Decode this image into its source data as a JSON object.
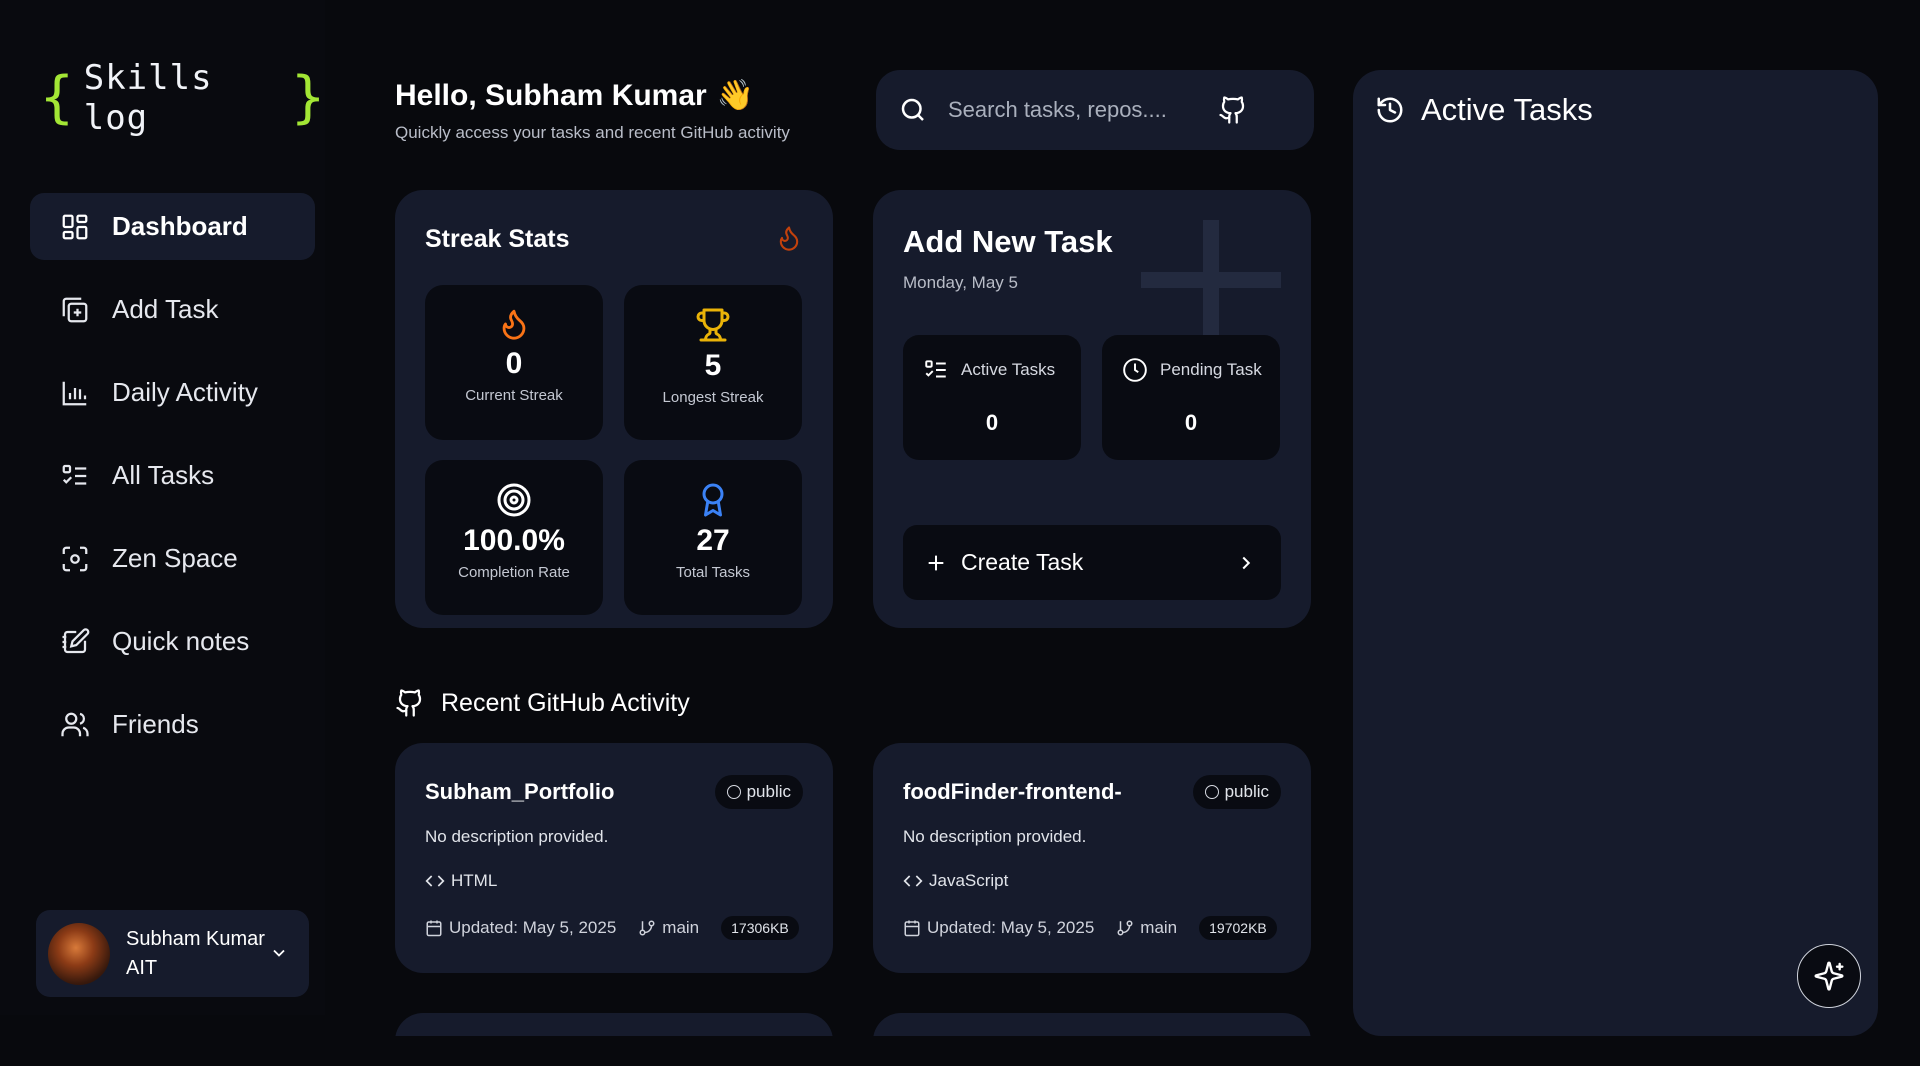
{
  "logo": {
    "open_brace": "{",
    "text": "Skills log",
    "close_brace": "}"
  },
  "sidebar": {
    "items": [
      {
        "label": "Dashboard",
        "icon": "dashboard-icon",
        "active": true
      },
      {
        "label": "Add Task",
        "icon": "add-task-icon"
      },
      {
        "label": "Daily Activity",
        "icon": "bar-chart-icon"
      },
      {
        "label": "All Tasks",
        "icon": "list-check-icon"
      },
      {
        "label": "Zen Space",
        "icon": "focus-icon"
      },
      {
        "label": "Quick notes",
        "icon": "notes-icon"
      },
      {
        "label": "Friends",
        "icon": "users-icon"
      }
    ]
  },
  "profile": {
    "name": "Subham Kumar",
    "org": "AIT"
  },
  "header": {
    "greeting": "Hello, Subham Kumar",
    "wave": "👋",
    "subtitle": "Quickly access your tasks and recent GitHub activity"
  },
  "search": {
    "placeholder": "Search tasks, repos...."
  },
  "streak": {
    "title": "Streak Stats",
    "stats": [
      {
        "value": "0",
        "label": "Current Streak",
        "icon": "flame-icon"
      },
      {
        "value": "5",
        "label": "Longest Streak",
        "icon": "trophy-icon"
      },
      {
        "value": "100.0%",
        "label": "Completion Rate",
        "icon": "target-icon"
      },
      {
        "value": "27",
        "label": "Total Tasks",
        "icon": "award-icon"
      }
    ]
  },
  "add_task": {
    "title": "Add New Task",
    "date": "Monday, May 5",
    "active_label": "Active Tasks",
    "active_count": "0",
    "pending_label": "Pending Task",
    "pending_count": "0",
    "create_label": "Create Task"
  },
  "github": {
    "title": "Recent GitHub Activity",
    "repos": [
      {
        "name": "Subham_Portfolio",
        "visibility": "public",
        "description": "No description provided.",
        "language": "HTML",
        "updated": "Updated: May 5, 2025",
        "branch": "main",
        "size": "17306KB"
      },
      {
        "name": "foodFinder-frontend-",
        "visibility": "public",
        "description": "No description provided.",
        "language": "JavaScript",
        "updated": "Updated: May 5, 2025",
        "branch": "main",
        "size": "19702KB"
      }
    ]
  },
  "active_panel": {
    "title": "Active Tasks"
  },
  "colors": {
    "accent_green": "#a3e635",
    "card_bg": "#161b2c",
    "inner_bg": "#090b12",
    "flame": "#f97316",
    "trophy": "#eab308",
    "award": "#3b82f6"
  }
}
